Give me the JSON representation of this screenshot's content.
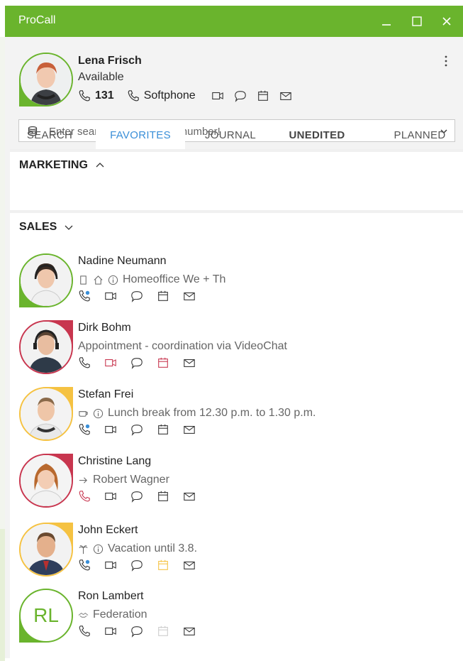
{
  "window": {
    "title": "ProCall"
  },
  "colors": {
    "brand": "#6ab42d",
    "available": "#6ab42d",
    "busy": "#c8364f",
    "away": "#f5c242",
    "accent": "#3a8fd8"
  },
  "profile": {
    "name": "Lena Frisch",
    "status": "Available",
    "extension": "131",
    "device": "Softphone",
    "action_icons": [
      "video-icon",
      "chat-icon",
      "calendar-icon",
      "mail-icon"
    ]
  },
  "search": {
    "placeholder": "Enter search term or phone number!",
    "value": ""
  },
  "tabs": [
    {
      "label": "SEARCH"
    },
    {
      "label": "FAVORITES",
      "active": true
    },
    {
      "label": "JOURNAL"
    },
    {
      "label": "UNEDITED",
      "bold": true
    },
    {
      "label": "PLANNED"
    }
  ],
  "groups": [
    {
      "label": "MARKETING",
      "expanded": false
    },
    {
      "label": "SALES",
      "expanded": true
    }
  ],
  "contacts": [
    {
      "name": "Nadine Neumann",
      "info": "Homeoffice We + Th",
      "status": "available"
    },
    {
      "name": "Dirk Bohm",
      "info": "Appointment - coordination via VideoChat",
      "status": "busy"
    },
    {
      "name": "Stefan Frei",
      "info": "Lunch break from 12.30 p.m. to 1.30 p.m.",
      "status": "away"
    },
    {
      "name": "Christine Lang",
      "info": "Robert Wagner",
      "status": "busy"
    },
    {
      "name": "John Eckert",
      "info": "Vacation until 3.8.",
      "status": "away"
    },
    {
      "name": "Ron Lambert",
      "info": "Federation",
      "status": "available",
      "initials": "RL"
    }
  ]
}
